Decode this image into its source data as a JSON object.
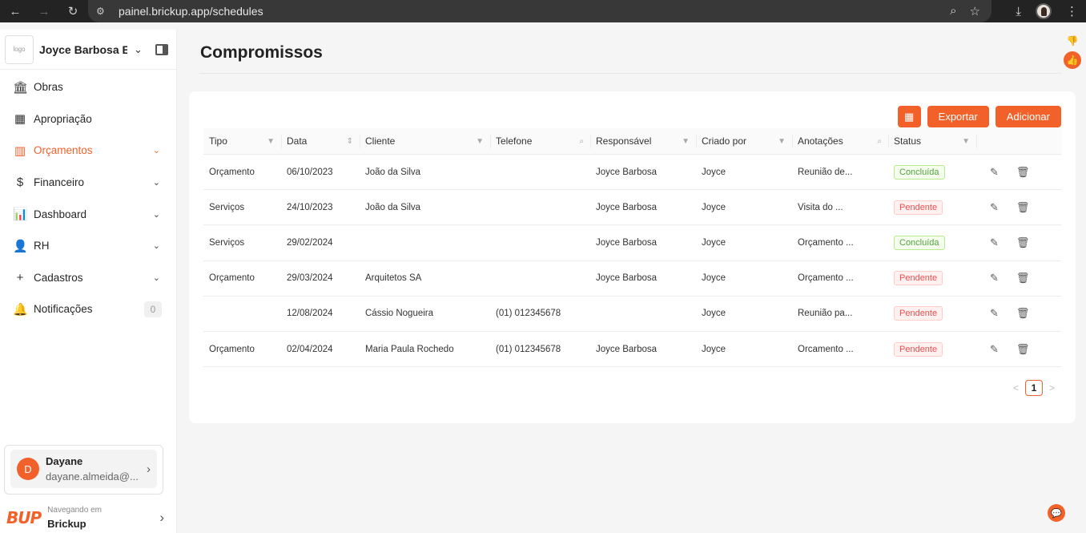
{
  "browser": {
    "back": "←",
    "forward": "→",
    "reload": "↻",
    "url": "painel.brickup.app/schedules",
    "icons": [
      "zoom-icon",
      "star-icon",
      "download-icon",
      "profile-icon",
      "menu-icon"
    ]
  },
  "sidebar": {
    "company_name": "Joyce Barbosa E...",
    "logo_text": "logo",
    "items": [
      {
        "label": "Obras",
        "icon": "🏛",
        "arrow": ""
      },
      {
        "label": "Apropriação",
        "icon": "▦",
        "arrow": ""
      },
      {
        "label": "Orçamentos",
        "icon": "▥",
        "arrow": "⌄"
      },
      {
        "label": "Financeiro",
        "icon": "$",
        "arrow": "⌄"
      },
      {
        "label": "Dashboard",
        "icon": "📊",
        "arrow": "⌄"
      },
      {
        "label": "RH",
        "icon": "👤",
        "arrow": "⌄"
      },
      {
        "label": "Cadastros",
        "icon": "+",
        "arrow": "⌄"
      },
      {
        "label": "Notificações",
        "icon": "🔔",
        "count": "0"
      }
    ],
    "user": {
      "initial": "D",
      "name": "Dayane",
      "email": "dayane.almeida@..."
    },
    "footer": {
      "brand": "BUP",
      "subtitle": "Navegando em",
      "workspace": "Brickup"
    }
  },
  "main": {
    "title": "Compromissos",
    "buttons": {
      "calendar_icon": "▦",
      "export": "Exportar",
      "add": "Adicionar"
    },
    "columns": [
      "Tipo",
      "Data",
      "Cliente",
      "Telefone",
      "Responsável",
      "Criado por",
      "Anotações",
      "Status"
    ],
    "rows": [
      {
        "tipo": "Orçamento",
        "data": "06/10/2023",
        "cliente": "João da Silva",
        "telefone": "",
        "responsavel": "Joyce Barbosa",
        "criado": "Joyce",
        "anotacoes": "Reunião de...",
        "status": "Concluída"
      },
      {
        "tipo": "Serviços",
        "data": "24/10/2023",
        "cliente": "João da Silva",
        "telefone": "",
        "responsavel": "Joyce Barbosa",
        "criado": "Joyce",
        "anotacoes": "Visita do ...",
        "status": "Pendente"
      },
      {
        "tipo": "Serviços",
        "data": "29/02/2024",
        "cliente": "",
        "telefone": "",
        "responsavel": "Joyce Barbosa",
        "criado": "Joyce",
        "anotacoes": "Orçamento ...",
        "status": "Concluída"
      },
      {
        "tipo": "Orçamento",
        "data": "29/03/2024",
        "cliente": "Arquitetos SA",
        "telefone": "",
        "responsavel": "Joyce Barbosa",
        "criado": "Joyce",
        "anotacoes": "Orçamento ...",
        "status": "Pendente"
      },
      {
        "tipo": "",
        "data": "12/08/2024",
        "cliente": "Cássio Nogueira",
        "telefone": "(01) 012345678",
        "responsavel": "",
        "criado": "Joyce",
        "anotacoes": "Reunião pa...",
        "status": "Pendente"
      },
      {
        "tipo": "Orçamento",
        "data": "02/04/2024",
        "cliente": "Maria Paula Rochedo",
        "telefone": "(01) 012345678",
        "responsavel": "Joyce Barbosa",
        "criado": "Joyce",
        "anotacoes": "Orcamento ...",
        "status": "Pendente"
      }
    ],
    "pagination": {
      "prev": "<",
      "current": "1",
      "next": ">"
    }
  },
  "colors": {
    "accent": "#f3612a",
    "success": "#52a043",
    "danger": "#ef4d4d"
  }
}
